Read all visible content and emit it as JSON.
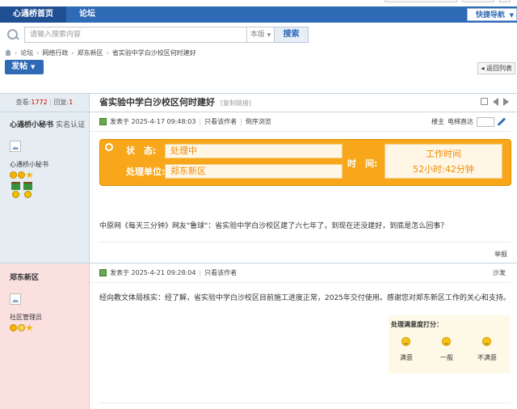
{
  "nav": {
    "tabs": [
      "心通桥首页",
      "论坛"
    ],
    "quick_nav": "快捷导航"
  },
  "search": {
    "placeholder": "请输入搜索内容",
    "scope": "本版",
    "button": "搜索"
  },
  "breadcrumb": [
    "论坛",
    "网络行政",
    "郑东新区",
    "省实验中学白沙校区何时建好"
  ],
  "actions": {
    "post": "发帖",
    "back": "返回列表"
  },
  "thread": {
    "views_label": "查看:",
    "views": "1772",
    "replies_label": "回复:",
    "replies": "1",
    "title": "省实验中学白沙校区何时建好",
    "copy_link": "[复制链接]"
  },
  "post1": {
    "author": "心通桥小秘书",
    "verified": "实名认证",
    "username": "心通桥小秘书",
    "posted": "发表于 2025-4-17 09:48:03",
    "only_author": "只看该作者",
    "reverse": "倒序浏览",
    "floor": "楼主",
    "elevator": "电梯直达",
    "status_label": "状　态:",
    "status": "处理中",
    "unit_label": "处理单位:",
    "unit": "郑东新区",
    "time_label": "时　间:",
    "time_title": "工作时间",
    "time_value": "52小时:42分钟",
    "content": "中原网《每天三分钟》网友\"鲁球\"：省实验中学白沙校区建了六七年了，到现在还没建好，到底是怎么回事？",
    "report": "举报"
  },
  "post2": {
    "author": "郑东新区",
    "username": "社区管理员",
    "posted": "发表于 2025-4-21 09:28:04",
    "only_author": "只看该作者",
    "floor": "沙发",
    "content": "经向教文体局核实：经了解，省实验中学白沙校区目前施工进度正常，2025年交付使用。感谢您对郑东新区工作的关心和支持。",
    "satisfaction": {
      "title": "处理满意度打分：",
      "options": [
        "满意",
        "一般",
        "不满意"
      ]
    }
  },
  "colors": {
    "brand": "#2f6ab6",
    "status_banner": "#f8a61a"
  }
}
